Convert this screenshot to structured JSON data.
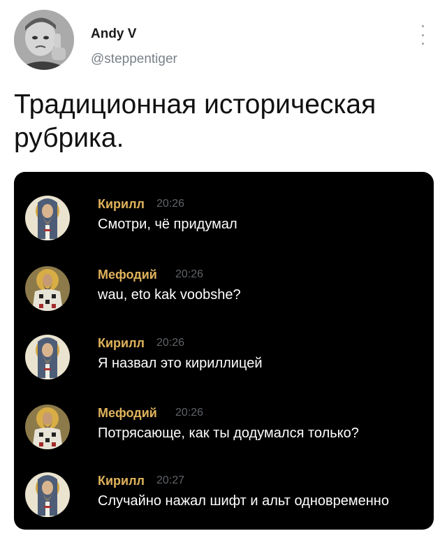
{
  "author": {
    "name": "Andy V",
    "handle": "@steppentiger",
    "avatar_icon": "user-avatar-icon"
  },
  "tweet": {
    "text_line1": "Традиционная историческая",
    "text_line2": "рубрика."
  },
  "colors": {
    "kirill": "#e0b35c",
    "mefodiy": "#e0b35c",
    "chat_bg": "#000000",
    "time": "#5f6368"
  },
  "chat": {
    "messages": [
      {
        "author": "Кирилл",
        "time": "20:26",
        "text": "Смотри, чё придумал",
        "avatar_icon": "icon-saint-kirill-avatar"
      },
      {
        "author": "Мефодий",
        "time": "20:26",
        "text": "wau, eto kak voobshe?",
        "avatar_icon": "icon-saint-mefodiy-avatar"
      },
      {
        "author": "Кирилл",
        "time": "20:26",
        "text": "Я назвал это кириллицей",
        "avatar_icon": "icon-saint-kirill-avatar"
      },
      {
        "author": "Мефодий",
        "time": "20:26",
        "text": "Потрясающе, как ты додумался только?",
        "avatar_icon": "icon-saint-mefodiy-avatar"
      },
      {
        "author": "Кирилл",
        "time": "20:27",
        "text": "Случайно нажал шифт и альт одновременно",
        "avatar_icon": "icon-saint-kirill-avatar"
      }
    ]
  }
}
